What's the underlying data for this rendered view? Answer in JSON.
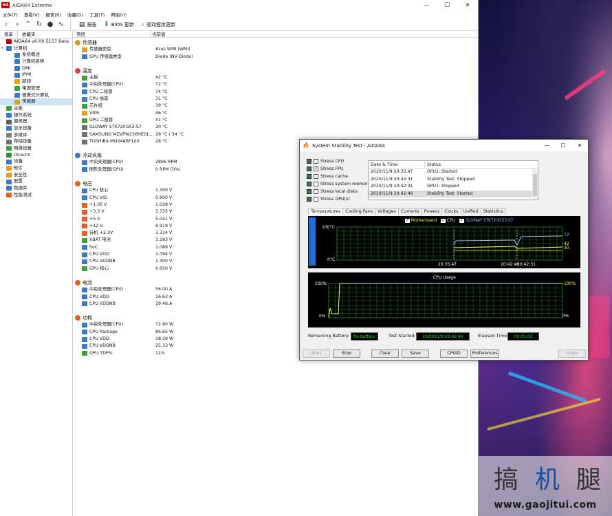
{
  "app": {
    "title": "AIDA64 Extreme",
    "icon_text": "64"
  },
  "menu": [
    "文件(F)",
    "查看(V)",
    "报告(R)",
    "收藏(O)",
    "工具(T)",
    "帮助(H)"
  ],
  "toolbar": {
    "report": "报告",
    "bios_update": "BIOS 更新",
    "driver_update": "驱动程序更新"
  },
  "left_tabs": [
    "菜单",
    "收藏夹"
  ],
  "tree": [
    {
      "label": "AIDA64 v6.00.5157 Beta",
      "level": 0,
      "exp": "",
      "color": "#c00000"
    },
    {
      "label": "计算机",
      "level": 0,
      "exp": "▾",
      "color": "#3c78c8"
    },
    {
      "label": "系统概述",
      "level": 1,
      "exp": "",
      "color": "#3c78c8"
    },
    {
      "label": "计算机名称",
      "level": 1,
      "exp": "",
      "color": "#3c78c8"
    },
    {
      "label": "DMI",
      "level": 1,
      "exp": "",
      "color": "#3c78c8"
    },
    {
      "label": "IPMI",
      "level": 1,
      "exp": "",
      "color": "#3c78c8"
    },
    {
      "label": "超频",
      "level": 1,
      "exp": "",
      "color": "#e8a020"
    },
    {
      "label": "电源管理",
      "level": 1,
      "exp": "",
      "color": "#40a040"
    },
    {
      "label": "便携式计算机",
      "level": 1,
      "exp": "",
      "color": "#3c78c8"
    },
    {
      "label": "传感器",
      "level": 1,
      "exp": "",
      "color": "#d0a020",
      "selected": true
    },
    {
      "label": "主板",
      "level": 0,
      "exp": "›",
      "color": "#40a040"
    },
    {
      "label": "操作系统",
      "level": 0,
      "exp": "›",
      "color": "#3c78c8"
    },
    {
      "label": "服务器",
      "level": 0,
      "exp": "›",
      "color": "#606060"
    },
    {
      "label": "显示设备",
      "level": 0,
      "exp": "›",
      "color": "#3c78c8"
    },
    {
      "label": "多媒体",
      "level": 0,
      "exp": "›",
      "color": "#808080"
    },
    {
      "label": "存储设备",
      "level": 0,
      "exp": "›",
      "color": "#707070"
    },
    {
      "label": "网络设备",
      "level": 0,
      "exp": "›",
      "color": "#40a040"
    },
    {
      "label": "DirectX",
      "level": 0,
      "exp": "›",
      "color": "#309030"
    },
    {
      "label": "设备",
      "level": 0,
      "exp": "›",
      "color": "#3c78c8"
    },
    {
      "label": "软件",
      "level": 0,
      "exp": "›",
      "color": "#e8a020"
    },
    {
      "label": "安全性",
      "level": 0,
      "exp": "›",
      "color": "#e8a020"
    },
    {
      "label": "配置",
      "level": 0,
      "exp": "›",
      "color": "#3c78c8"
    },
    {
      "label": "数据库",
      "level": 0,
      "exp": "›",
      "color": "#3c78c8"
    },
    {
      "label": "性能测试",
      "level": 0,
      "exp": "›",
      "color": "#e86020"
    }
  ],
  "columns": {
    "item": "项目",
    "value": "当前值"
  },
  "sections": [
    {
      "title": "传感器",
      "color": "#d0a020",
      "rows": [
        {
          "label": "传感器类型",
          "value": "Asus WMI  (WMI)",
          "color": "#d0a020"
        },
        {
          "label": "GPU 传感器类型",
          "value": "Diode  (NV-Diode)",
          "color": "#3c78c8"
        }
      ]
    },
    {
      "title": "温度",
      "color": "#e04040",
      "rows": [
        {
          "label": "主板",
          "value": "42 °C",
          "color": "#40a040"
        },
        {
          "label": "中央处理器(CPU)",
          "value": "72 °C",
          "color": "#3c78c8"
        },
        {
          "label": "CPU 二极管",
          "value": "74 °C",
          "color": "#3c78c8"
        },
        {
          "label": "CPU 插座",
          "value": "31 °C",
          "color": "#3c78c8"
        },
        {
          "label": "芯片组",
          "value": "39 °C",
          "color": "#40a040"
        },
        {
          "label": "VRM",
          "value": "46 °C",
          "color": "#e8a020"
        },
        {
          "label": "GPU 二极管",
          "value": "41 °C",
          "color": "#40a040"
        },
        {
          "label": "GLOWAY STK720GS3-S7",
          "value": "30 °C",
          "color": "#707070"
        },
        {
          "label": "SAMSUNG MZVPW256HEGL...",
          "value": "29 °C / 34 °C",
          "color": "#707070"
        },
        {
          "label": "TOSHIBA MQ04ABF100",
          "value": "28 °C",
          "color": "#707070"
        }
      ]
    },
    {
      "title": "冷却风扇",
      "color": "#3c78c8",
      "rows": [
        {
          "label": "中央处理器(CPU)",
          "value": "2896 RPM",
          "color": "#3c78c8"
        },
        {
          "label": "图形处理器(GPU)",
          "value": "0 RPM  (0%)",
          "color": "#3c78c8"
        }
      ]
    },
    {
      "title": "电压",
      "color": "#e86020",
      "rows": [
        {
          "label": "CPU 核心",
          "value": "1.300 V",
          "color": "#3c78c8"
        },
        {
          "label": "CPU VID",
          "value": "0.900 V",
          "color": "#3c78c8"
        },
        {
          "label": "+1.05 V",
          "value": "1.028 V",
          "color": "#e86020"
        },
        {
          "label": "+3.3 V",
          "value": "3.335 V",
          "color": "#e86020"
        },
        {
          "label": "+5 V",
          "value": "5.041 V",
          "color": "#e86020"
        },
        {
          "label": "+12 V",
          "value": "9.919 V",
          "color": "#e86020"
        },
        {
          "label": "待机 +3.3V",
          "value": "3.314 V",
          "color": "#e86020"
        },
        {
          "label": "VBAT 电池",
          "value": "3.183 V",
          "color": "#40a040"
        },
        {
          "label": "SoC",
          "value": "1.089 V",
          "color": "#3c78c8"
        },
        {
          "label": "CPU VDD",
          "value": "1.094 V",
          "color": "#3c78c8"
        },
        {
          "label": "CPU VDDNB",
          "value": "1.300 V",
          "color": "#3c78c8"
        },
        {
          "label": "GPU 核心",
          "value": "0.650 V",
          "color": "#40a040"
        }
      ]
    },
    {
      "title": "电流",
      "color": "#e86020",
      "rows": [
        {
          "label": "中央处理器(CPU)",
          "value": "56.00 A",
          "color": "#3c78c8"
        },
        {
          "label": "CPU VDD",
          "value": "16.63 A",
          "color": "#3c78c8"
        },
        {
          "label": "CPU VDDNB",
          "value": "19.48 A",
          "color": "#3c78c8"
        }
      ]
    },
    {
      "title": "功耗",
      "color": "#e86020",
      "rows": [
        {
          "label": "中央处理器(CPU)",
          "value": "72.80 W",
          "color": "#3c78c8"
        },
        {
          "label": "CPU Package",
          "value": "86.65 W",
          "color": "#3c78c8"
        },
        {
          "label": "CPU VDD",
          "value": "18.19 W",
          "color": "#3c78c8"
        },
        {
          "label": "CPU VDDNB",
          "value": "25.33 W",
          "color": "#3c78c8"
        },
        {
          "label": "GPU TDP%",
          "value": "11%",
          "color": "#40a040"
        }
      ]
    }
  ],
  "dialog": {
    "title": "System Stability Test - AIDA64",
    "stress": [
      {
        "label": "Stress CPU",
        "checked": false
      },
      {
        "label": "Stress FPU",
        "checked": true
      },
      {
        "label": "Stress cache",
        "checked": false
      },
      {
        "label": "Stress system memory",
        "checked": false
      },
      {
        "label": "Stress local disks",
        "checked": false
      },
      {
        "label": "Stress GPU(s)",
        "checked": false
      }
    ],
    "log_headers": {
      "date": "Date & Time",
      "status": "Status"
    },
    "log": [
      {
        "date": "2020/11/9 20:35:47",
        "status": "GPU1: Started"
      },
      {
        "date": "2020/11/9 20:42:31",
        "status": "Stability Test: Stopped"
      },
      {
        "date": "2020/11/9 20:42:31",
        "status": "GPU1: Stopped"
      },
      {
        "date": "2020/11/9 20:42:46",
        "status": "Stability Test: Started",
        "selected": true
      }
    ],
    "tabs": [
      "Temperatures",
      "Cooling Fans",
      "Voltages",
      "Currents",
      "Powers",
      "Clocks",
      "Unified",
      "Statistics"
    ],
    "temp_graph": {
      "legend": [
        "Motherboard",
        "CPU",
        "GLOWAY STK720GS3-S7"
      ],
      "y_top": "100°C",
      "y_bottom": "0°C",
      "x_labels": [
        "20:35:47",
        "20:42:46",
        "20:42:31"
      ],
      "right_values": [
        "72",
        "42",
        "30"
      ]
    },
    "cpu_graph": {
      "title": "CPU Usage",
      "y_top": "100%",
      "y_bottom": "0%",
      "right_top": "100%",
      "right_bottom": "0%"
    },
    "status": {
      "battery_label": "Remaining Battery:",
      "battery_value": "No battery",
      "started_label": "Test Started:",
      "started_value": "2020/11/9 20:42:46",
      "elapsed_label": "Elapsed Time:",
      "elapsed_value": "00:05:03"
    },
    "buttons": [
      "Start",
      "Stop",
      "Clear",
      "Save",
      "CPUID",
      "Preferences",
      "Close"
    ]
  },
  "watermark": {
    "chars": [
      "搞",
      "机",
      "腿"
    ],
    "url": "www.gaojitui.com"
  }
}
